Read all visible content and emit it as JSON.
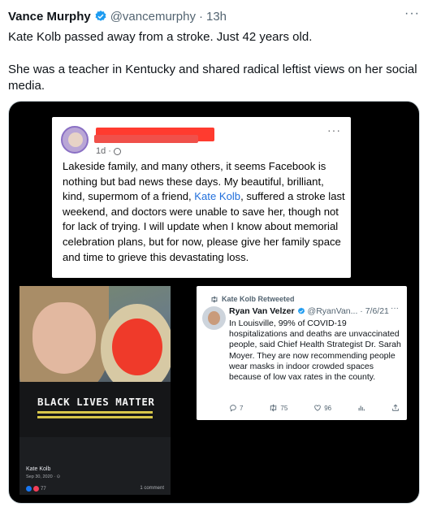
{
  "tweet": {
    "author_name": "Vance Murphy",
    "handle": "@vancemurphy",
    "separator": "·",
    "time": "13h",
    "more": "···",
    "paragraphs": [
      "Kate Kolb passed away from a stroke. Just 42 years old.",
      "She was a teacher in Kentucky and shared radical leftist views on her social media."
    ]
  },
  "fb_post": {
    "meta_time": "1d ·",
    "more": "···",
    "text_before": "Lakeside family, and many others, it seems Facebook is nothing but bad news these days. My beautiful, brilliant, kind, supermom of a friend, ",
    "link_text": "Kate Kolb",
    "text_after": ", suffered a stroke last weekend, and doctors were unable to save her, though not for lack of trying. I will update when I know about memorial celebration plans, but for now, please give her family space and time to grieve this devastating loss."
  },
  "photo_post": {
    "shirt_text": "BLACK LIVES MATTER",
    "name": "Kate Kolb",
    "date": "Sep 30, 2020 · ⊙",
    "reactions_count": "77",
    "comments": "1 comment"
  },
  "retweet": {
    "label": "Kate Kolb Retweeted",
    "name": "Ryan Van Velzer",
    "handle": "@RyanVan... · 7/6/21",
    "more": "···",
    "text": "In Louisville, 99% of COVID-19 hospitalizations and deaths are unvaccinated people, said Chief Health Strategist Dr. Sarah Moyer. They are now recommending people wear masks in indoor crowded spaces because of low vax rates in the county.",
    "replies": "7",
    "retweets": "75",
    "likes": "96"
  },
  "colors": {
    "verified_blue": "#1d9bf0",
    "link_blue": "#216fdb",
    "redaction_red": "#ff3b2f",
    "muted_gray": "#536471"
  },
  "icons": [
    "verified-badge-icon",
    "globe-icon",
    "retweet-icon",
    "reply-icon",
    "like-icon",
    "analytics-icon",
    "share-icon"
  ]
}
